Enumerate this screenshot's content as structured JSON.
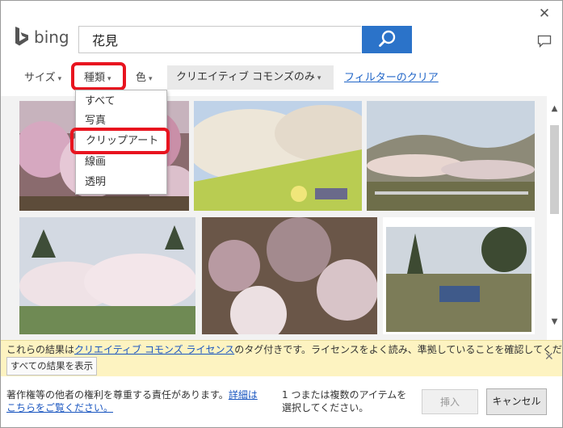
{
  "window": {
    "close_icon": "close-icon",
    "feedback_icon": "speech-bubble-icon"
  },
  "logo": {
    "text": "bing"
  },
  "search": {
    "value": "花見",
    "button_icon": "search-icon"
  },
  "filters": {
    "size_label": "サイズ",
    "type_label": "種類",
    "color_label": "色",
    "cc_label": "クリエイティブ コモンズのみ",
    "clear_label": "フィルターのクリア"
  },
  "type_menu": {
    "items": [
      "すべて",
      "写真",
      "クリップアート",
      "線画",
      "透明"
    ],
    "highlighted": "クリップアート"
  },
  "colors": {
    "accent": "#2b73c9",
    "highlight": "#e8141f",
    "notice_bg": "#fdf3c1",
    "link": "#1a56c0"
  },
  "notice": {
    "text_before": "これらの結果は",
    "link": "クリエイティブ コモンズ ライセンス",
    "text_after": "のタグ付きです。ライセンスをよく読み、準拠していることを確認してください。",
    "show_all": "すべての結果を表示"
  },
  "footer": {
    "copyright_text": "著作権等の他者の権利を尊重する責任があります。",
    "details_link": "詳細はこちらをご覧ください。",
    "selection_hint": "1 つまたは複数のアイテムを選択してください。",
    "insert_label": "挿入",
    "cancel_label": "キャンセル"
  }
}
